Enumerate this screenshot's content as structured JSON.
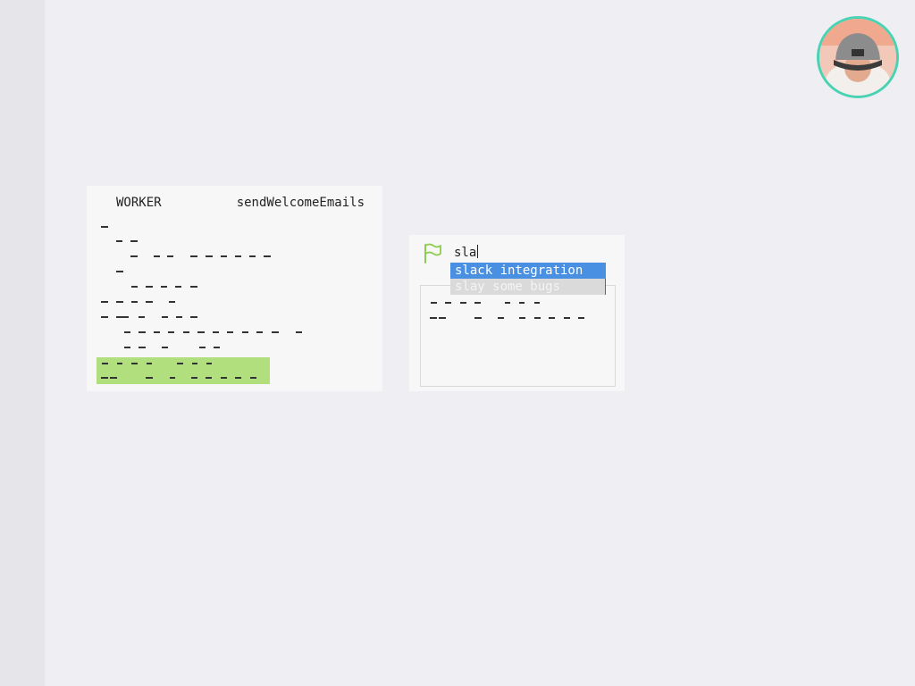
{
  "worker_card": {
    "label": "WORKER",
    "name": "sendWelcomeEmails"
  },
  "task_card": {
    "input_value": "sla",
    "suggestions": [
      "slack integration",
      "slay some bugs"
    ]
  },
  "user": {
    "avatar_icon": "user-avatar-icon"
  },
  "colors": {
    "highlight": "#b2df7e",
    "selected_suggestion": "#4a90e2",
    "flag": "#8ccd4f",
    "avatar_ring": "#48d3b4"
  }
}
